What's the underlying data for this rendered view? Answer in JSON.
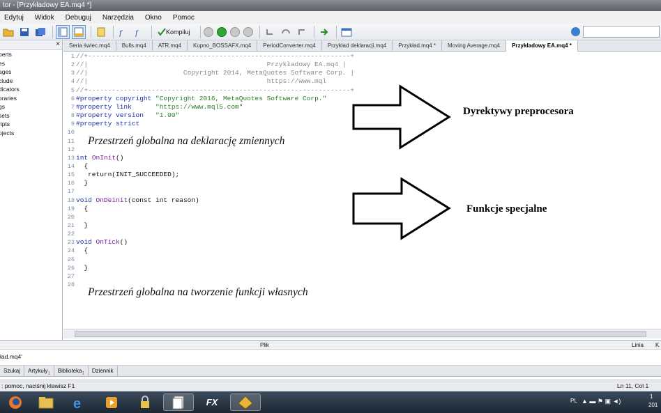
{
  "window": {
    "title": "tor - [Przykładowy EA.mq4 *]"
  },
  "menu": [
    "Edytuj",
    "Widok",
    "Debuguj",
    "Narzędzia",
    "Okno",
    "Pomoc"
  ],
  "toolbar": {
    "compile_label": "Kompiluj",
    "icons": [
      "open-icon",
      "save-icon",
      "save-all-icon",
      "navigator-icon",
      "toolbox-icon",
      "new-icon",
      "function-icon",
      "function-list-icon",
      "compile-icon",
      "gear-icon",
      "play-icon",
      "pause-icon",
      "stop-icon",
      "step-into-icon",
      "step-over-icon",
      "step-out-icon",
      "arrow-right-icon",
      "window-icon"
    ],
    "accent_color": "#3b7fd1"
  },
  "navigator": {
    "items": [
      "perts",
      "es",
      "ages",
      "clude",
      "dicators",
      "oraries",
      "gs",
      "sets",
      "ripts",
      "ojects"
    ]
  },
  "tabs": [
    "Seria świec.mq4",
    "Bulls.mq4",
    "ATR.mq4",
    "Kupno_BOSSAFX.mq4",
    "PeriodConverter.mq4",
    "Przykład deklaracji.mq4",
    "Przykład.mq4 *",
    "Moving Average.mq4",
    "Przykładowy EA.mq4 *"
  ],
  "editor": {
    "lines": [
      {
        "n": "1",
        "text": "//+------------------------------------------------------------------+"
      },
      {
        "n": "2",
        "text": "//|                                             Przykładowy EA.mq4 |"
      },
      {
        "n": "3",
        "text": "//|                        Copyright 2014, MetaQuotes Software Corp. |"
      },
      {
        "n": "4",
        "text": "//|                                             https://www.mql   "
      },
      {
        "n": "5",
        "text": "//+------------------------------------------------------------------+"
      },
      {
        "n": "6",
        "kw": "#property copyright",
        "str": "\"Copyright 2016, MetaQuotes Software Corp.\""
      },
      {
        "n": "7",
        "kw": "#property link     ",
        "str": "\"https://www.mql5.com\""
      },
      {
        "n": "8",
        "kw": "#property version  ",
        "str": "\"1.00\""
      },
      {
        "n": "9",
        "kw": "#property strict",
        "str": ""
      },
      {
        "n": "10",
        "text": ""
      },
      {
        "n": "11",
        "text": ""
      },
      {
        "n": "12",
        "text": ""
      },
      {
        "n": "13",
        "kw": "int ",
        "fn": "OnInit",
        "rest": "()"
      },
      {
        "n": "14",
        "text": "  {"
      },
      {
        "n": "15",
        "text": "   return(INIT_SUCCEEDED);"
      },
      {
        "n": "16",
        "text": "  }"
      },
      {
        "n": "17",
        "text": ""
      },
      {
        "n": "18",
        "kw": "void ",
        "fn": "OnDeinit",
        "rest": "(const int reason)"
      },
      {
        "n": "19",
        "text": "  {"
      },
      {
        "n": "20",
        "text": ""
      },
      {
        "n": "21",
        "text": "  }"
      },
      {
        "n": "22",
        "text": ""
      },
      {
        "n": "23",
        "kw": "void ",
        "fn": "OnTick",
        "rest": "()"
      },
      {
        "n": "24",
        "text": "  {"
      },
      {
        "n": "25",
        "text": ""
      },
      {
        "n": "26",
        "text": "  }"
      },
      {
        "n": "27",
        "text": ""
      },
      {
        "n": "28",
        "text": ""
      }
    ],
    "annotation_global_vars": "Przestrzeń globalna na deklarację zmiennych",
    "annotation_global_funcs": "Przestrzeń globalna na tworzenie funkcji własnych",
    "label_preprocessor": "Dyrektywy preprocesora",
    "label_special": "Funkcje specjalne"
  },
  "output": {
    "col_file": "Plik",
    "col_line": "Linia",
    "col_extra": "K",
    "row_file": "ład.mq4'"
  },
  "bottom_tabs": [
    {
      "label": "Szukaj",
      "count": ""
    },
    {
      "label": "Artykuły",
      "count": "1"
    },
    {
      "label": "Biblioteka",
      "count": "1"
    },
    {
      "label": "Dziennik",
      "count": ""
    }
  ],
  "status": {
    "help": ": pomoc, naciśnij klawisz F1",
    "position": "Ln 11, Col 1"
  },
  "taskbar": {
    "apps": [
      "firefox-icon",
      "explorer-icon",
      "ie-icon",
      "media-player-icon",
      "lock-icon",
      "documents-icon",
      "fx-icon",
      "metaeditor-icon"
    ],
    "fx_label": "FX",
    "tray_lang": "PL",
    "tray_time": "1",
    "tray_date": "201"
  }
}
